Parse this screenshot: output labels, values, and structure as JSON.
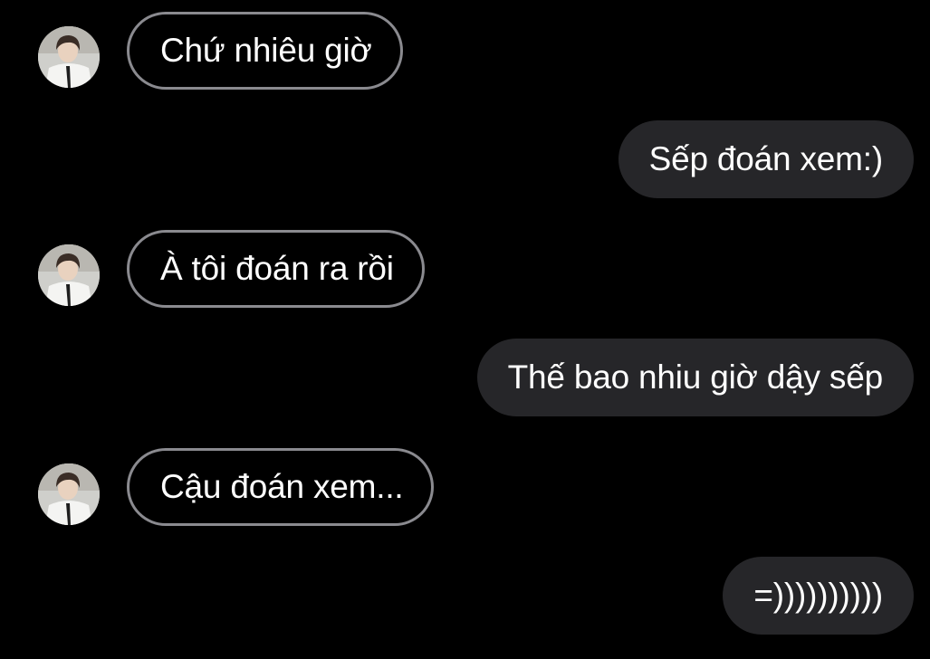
{
  "colors": {
    "background": "#000000",
    "incoming_border": "#8a8a8f",
    "outgoing_bubble": "#262629",
    "text": "#ffffff"
  },
  "contact": {
    "avatar_icon": "profile-photo-icon"
  },
  "messages": [
    {
      "direction": "incoming",
      "text": "Chứ nhiêu giờ"
    },
    {
      "direction": "outgoing",
      "text": "Sếp đoán xem:)"
    },
    {
      "direction": "incoming",
      "text": "À tôi đoán ra rồi"
    },
    {
      "direction": "outgoing",
      "text": "Thế bao nhiu giờ dậy sếp"
    },
    {
      "direction": "incoming",
      "text": "Cậu đoán xem..."
    },
    {
      "direction": "outgoing",
      "text": "=))))))))))"
    }
  ]
}
